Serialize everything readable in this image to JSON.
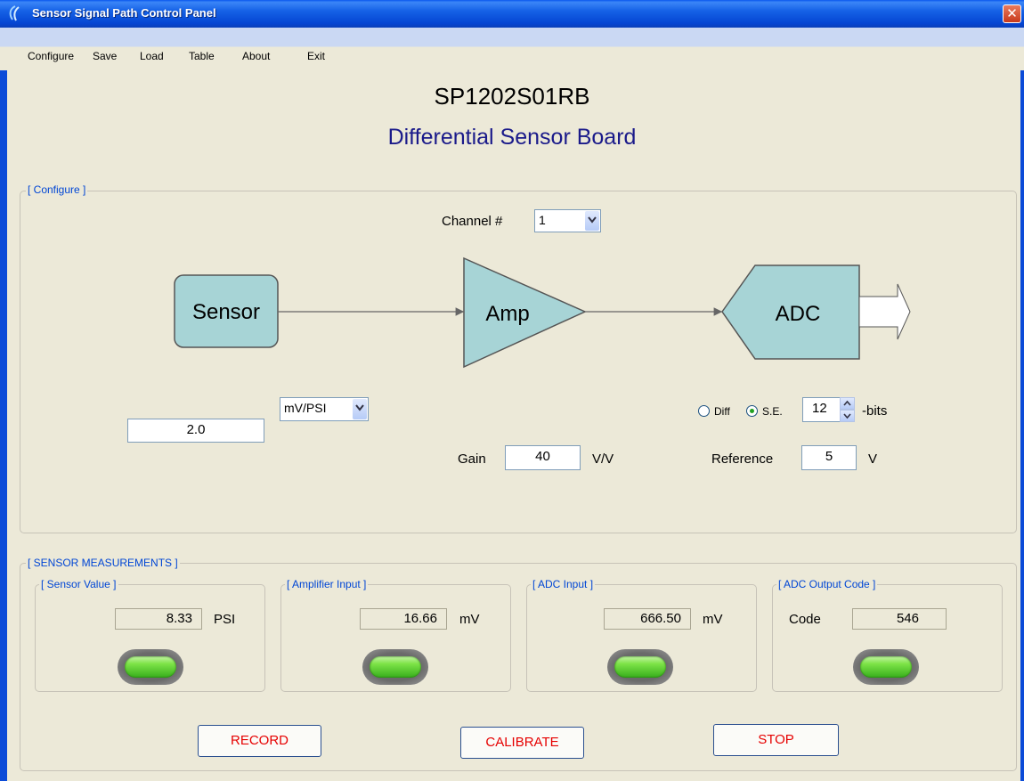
{
  "window": {
    "title": "Sensor Signal Path Control Panel"
  },
  "menu": [
    "Configure",
    "Save",
    "Load",
    "Table",
    "About",
    "Exit"
  ],
  "header": {
    "part_number": "SP1202S01RB",
    "board_name": "Differential Sensor Board"
  },
  "configure": {
    "legend": "[ Configure ]",
    "channel_label": "Channel #",
    "channel_value": "1",
    "blocks": {
      "sensor": "Sensor",
      "amp": "Amp",
      "adc": "ADC"
    },
    "sensitivity_value": "2.0",
    "sensitivity_unit": "mV/PSI",
    "gain_label": "Gain",
    "gain_value": "40",
    "gain_unit": "V/V",
    "mode_diff": "Diff",
    "mode_se": "S.E.",
    "mode_selected": "S.E.",
    "bits_value": "12",
    "bits_label": "-bits",
    "reference_label": "Reference",
    "reference_value": "5",
    "reference_unit": "V"
  },
  "measurements": {
    "legend": "[ SENSOR MEASUREMENTS ]",
    "sensor_value": {
      "legend": "[ Sensor Value ]",
      "value": "8.33",
      "unit": "PSI"
    },
    "amplifier_input": {
      "legend": "[ Amplifier Input ]",
      "value": "16.66",
      "unit": "mV"
    },
    "adc_input": {
      "legend": "[ ADC Input ]",
      "value": "666.50",
      "unit": "mV"
    },
    "adc_output": {
      "legend": "[ ADC Output Code ]",
      "label": "Code",
      "value": "546"
    }
  },
  "buttons": {
    "record": "RECORD",
    "calibrate": "CALIBRATE",
    "stop": "STOP"
  },
  "colors": {
    "block_fill": "#a7d4d6",
    "button_text": "#e60000",
    "legend_text": "#0046d5",
    "led": "#4cc62a"
  }
}
